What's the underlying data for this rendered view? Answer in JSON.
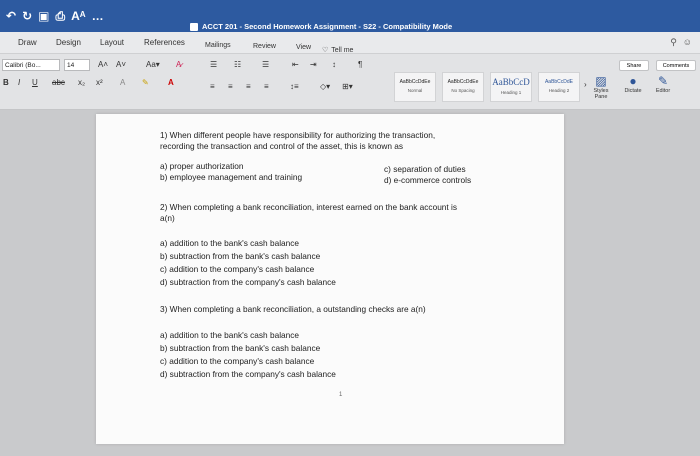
{
  "window": {
    "title": "ACCT 201 - Second Homework Assignment - S22 - Compatibility Mode"
  },
  "tabs": [
    "Draw",
    "Design",
    "Layout",
    "References",
    "Mailings",
    "Review",
    "View"
  ],
  "tell_me": "Tell me",
  "ribbon": {
    "font_name": "Calibri (Bo...",
    "font_size": "14",
    "styles": [
      {
        "sample": "AaBbCcDdEe",
        "name": "Normal"
      },
      {
        "sample": "AaBbCcDdEe",
        "name": "No Spacing"
      },
      {
        "sample": "AaBbCcD",
        "name": "Heading 1"
      },
      {
        "sample": "AaBbCcDdE",
        "name": "Heading 2"
      }
    ],
    "styles_pane": "Styles Pane",
    "dictate": "Dictate",
    "editor": "Editor",
    "share": "Share",
    "comments": "Comments"
  },
  "document": {
    "q1": {
      "line1": "1) When different people have responsibility for authorizing the transaction,",
      "line2": "recording the transaction and control of the asset, this is known as",
      "a": "a) proper authorization",
      "b": "b) employee management and training",
      "c": "c) separation of duties",
      "d": "d) e-commerce controls"
    },
    "q2": {
      "line1": "2) When completing a bank reconciliation, interest earned on the bank account is",
      "line2": "a(n)",
      "a": "a) addition to the bank's cash balance",
      "b": "b) subtraction from the bank's cash balance",
      "c": "c) addition to the company's cash balance",
      "d": "d) subtraction from the company's cash balance"
    },
    "q3": {
      "line1": "3) When completing a bank reconciliation, a outstanding checks are a(n)",
      "a": "a) addition to the bank's cash balance",
      "b": "b) subtraction from the bank's cash balance",
      "c": "c) addition to the company's cash balance",
      "d": "d) subtraction from the company's cash balance"
    },
    "page_number": "1"
  }
}
